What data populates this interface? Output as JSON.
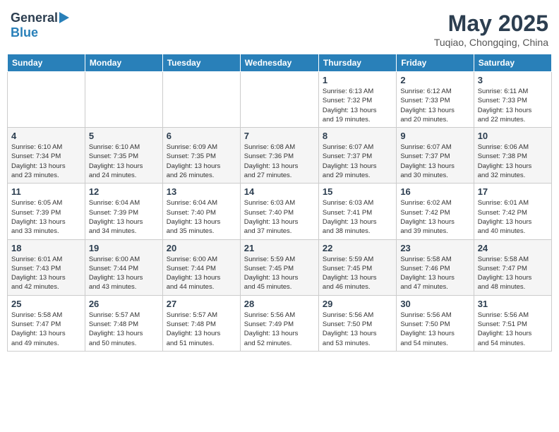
{
  "header": {
    "logo_general": "General",
    "logo_blue": "Blue",
    "month_year": "May 2025",
    "location": "Tuqiao, Chongqing, China"
  },
  "weekdays": [
    "Sunday",
    "Monday",
    "Tuesday",
    "Wednesday",
    "Thursday",
    "Friday",
    "Saturday"
  ],
  "weeks": [
    [
      {
        "day": "",
        "info": ""
      },
      {
        "day": "",
        "info": ""
      },
      {
        "day": "",
        "info": ""
      },
      {
        "day": "",
        "info": ""
      },
      {
        "day": "1",
        "info": "Sunrise: 6:13 AM\nSunset: 7:32 PM\nDaylight: 13 hours\nand 19 minutes."
      },
      {
        "day": "2",
        "info": "Sunrise: 6:12 AM\nSunset: 7:33 PM\nDaylight: 13 hours\nand 20 minutes."
      },
      {
        "day": "3",
        "info": "Sunrise: 6:11 AM\nSunset: 7:33 PM\nDaylight: 13 hours\nand 22 minutes."
      }
    ],
    [
      {
        "day": "4",
        "info": "Sunrise: 6:10 AM\nSunset: 7:34 PM\nDaylight: 13 hours\nand 23 minutes."
      },
      {
        "day": "5",
        "info": "Sunrise: 6:10 AM\nSunset: 7:35 PM\nDaylight: 13 hours\nand 24 minutes."
      },
      {
        "day": "6",
        "info": "Sunrise: 6:09 AM\nSunset: 7:35 PM\nDaylight: 13 hours\nand 26 minutes."
      },
      {
        "day": "7",
        "info": "Sunrise: 6:08 AM\nSunset: 7:36 PM\nDaylight: 13 hours\nand 27 minutes."
      },
      {
        "day": "8",
        "info": "Sunrise: 6:07 AM\nSunset: 7:37 PM\nDaylight: 13 hours\nand 29 minutes."
      },
      {
        "day": "9",
        "info": "Sunrise: 6:07 AM\nSunset: 7:37 PM\nDaylight: 13 hours\nand 30 minutes."
      },
      {
        "day": "10",
        "info": "Sunrise: 6:06 AM\nSunset: 7:38 PM\nDaylight: 13 hours\nand 32 minutes."
      }
    ],
    [
      {
        "day": "11",
        "info": "Sunrise: 6:05 AM\nSunset: 7:39 PM\nDaylight: 13 hours\nand 33 minutes."
      },
      {
        "day": "12",
        "info": "Sunrise: 6:04 AM\nSunset: 7:39 PM\nDaylight: 13 hours\nand 34 minutes."
      },
      {
        "day": "13",
        "info": "Sunrise: 6:04 AM\nSunset: 7:40 PM\nDaylight: 13 hours\nand 35 minutes."
      },
      {
        "day": "14",
        "info": "Sunrise: 6:03 AM\nSunset: 7:40 PM\nDaylight: 13 hours\nand 37 minutes."
      },
      {
        "day": "15",
        "info": "Sunrise: 6:03 AM\nSunset: 7:41 PM\nDaylight: 13 hours\nand 38 minutes."
      },
      {
        "day": "16",
        "info": "Sunrise: 6:02 AM\nSunset: 7:42 PM\nDaylight: 13 hours\nand 39 minutes."
      },
      {
        "day": "17",
        "info": "Sunrise: 6:01 AM\nSunset: 7:42 PM\nDaylight: 13 hours\nand 40 minutes."
      }
    ],
    [
      {
        "day": "18",
        "info": "Sunrise: 6:01 AM\nSunset: 7:43 PM\nDaylight: 13 hours\nand 42 minutes."
      },
      {
        "day": "19",
        "info": "Sunrise: 6:00 AM\nSunset: 7:44 PM\nDaylight: 13 hours\nand 43 minutes."
      },
      {
        "day": "20",
        "info": "Sunrise: 6:00 AM\nSunset: 7:44 PM\nDaylight: 13 hours\nand 44 minutes."
      },
      {
        "day": "21",
        "info": "Sunrise: 5:59 AM\nSunset: 7:45 PM\nDaylight: 13 hours\nand 45 minutes."
      },
      {
        "day": "22",
        "info": "Sunrise: 5:59 AM\nSunset: 7:45 PM\nDaylight: 13 hours\nand 46 minutes."
      },
      {
        "day": "23",
        "info": "Sunrise: 5:58 AM\nSunset: 7:46 PM\nDaylight: 13 hours\nand 47 minutes."
      },
      {
        "day": "24",
        "info": "Sunrise: 5:58 AM\nSunset: 7:47 PM\nDaylight: 13 hours\nand 48 minutes."
      }
    ],
    [
      {
        "day": "25",
        "info": "Sunrise: 5:58 AM\nSunset: 7:47 PM\nDaylight: 13 hours\nand 49 minutes."
      },
      {
        "day": "26",
        "info": "Sunrise: 5:57 AM\nSunset: 7:48 PM\nDaylight: 13 hours\nand 50 minutes."
      },
      {
        "day": "27",
        "info": "Sunrise: 5:57 AM\nSunset: 7:48 PM\nDaylight: 13 hours\nand 51 minutes."
      },
      {
        "day": "28",
        "info": "Sunrise: 5:56 AM\nSunset: 7:49 PM\nDaylight: 13 hours\nand 52 minutes."
      },
      {
        "day": "29",
        "info": "Sunrise: 5:56 AM\nSunset: 7:50 PM\nDaylight: 13 hours\nand 53 minutes."
      },
      {
        "day": "30",
        "info": "Sunrise: 5:56 AM\nSunset: 7:50 PM\nDaylight: 13 hours\nand 54 minutes."
      },
      {
        "day": "31",
        "info": "Sunrise: 5:56 AM\nSunset: 7:51 PM\nDaylight: 13 hours\nand 54 minutes."
      }
    ]
  ]
}
